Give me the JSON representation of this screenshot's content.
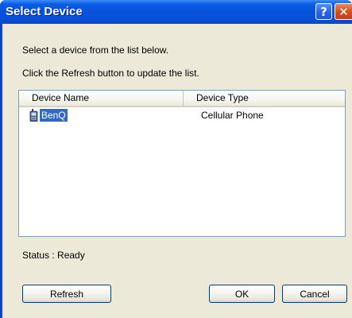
{
  "window": {
    "title": "Select Device",
    "help_glyph": "?",
    "close_glyph": "✕"
  },
  "instructions": {
    "line1": "Select a device from the list below.",
    "line2": "Click the Refresh button to update the list."
  },
  "device_list": {
    "columns": [
      "Device Name",
      "Device Type"
    ],
    "rows": [
      {
        "name": "BenQ",
        "type": "Cellular Phone",
        "icon": "cellphone-icon",
        "selected": true
      }
    ]
  },
  "status": {
    "text": "Status : Ready"
  },
  "buttons": {
    "refresh": "Refresh",
    "ok": "OK",
    "cancel": "Cancel"
  },
  "colors": {
    "titlebar": "#0753dc",
    "selection": "#316ac5",
    "dialog_face": "#ece9d8",
    "close_button": "#d4501f"
  }
}
